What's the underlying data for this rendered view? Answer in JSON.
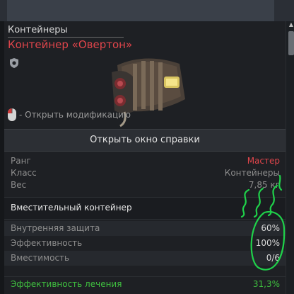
{
  "tooltip": {
    "category": "Контейнеры",
    "title": "Контейнер «Овертон»",
    "mouse_hint": "- Открыть модификацию",
    "help_button": "Открыть окно справки",
    "stats": [
      {
        "key": "Ранг",
        "value": "Мастер"
      },
      {
        "key": "Класс",
        "value": "Контейнеры"
      },
      {
        "key": "Вес",
        "value": "7,85 кг"
      }
    ],
    "section_label": "Вместительный контейнер",
    "props": [
      {
        "key": "Внутренняя защита",
        "value": "60%"
      },
      {
        "key": "Эффективность",
        "value": "100%"
      },
      {
        "key": "Вместимость",
        "value": "0/6"
      }
    ],
    "heal": {
      "key": "Эффективность лечения",
      "value": "31,3%"
    }
  },
  "colors": {
    "accent_red": "#e0454b",
    "heal_green": "#3fbf3f",
    "scribble_green": "#1fd14a"
  },
  "icons": [
    "shield-icon",
    "mouse-icon",
    "container-image"
  ]
}
